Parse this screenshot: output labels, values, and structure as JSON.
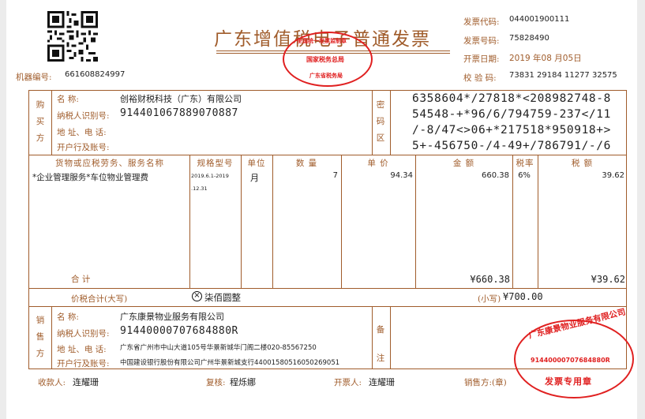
{
  "header": {
    "title": "广东增值税电子普通发票",
    "machine_no_label": "机器编号:",
    "machine_no": "661608824997",
    "invoice_code_label": "发票代码:",
    "invoice_code": "044001900111",
    "invoice_no_label": "发票号码:",
    "invoice_no": "75828490",
    "issue_date_label": "开票日期:",
    "issue_date": "2019 年08 月05日",
    "check_code_label": "校 验 码:",
    "check_code": "73831 29184 11277 32575"
  },
  "tax_stamp": {
    "line1": "全国统一发票监制章",
    "line2": "国家税务总局",
    "line3": "广东省税务局"
  },
  "buyer": {
    "section_label": "购买方",
    "name_label": "名      称:",
    "name": "创裕财税科技（广东）有限公司",
    "tax_id_label": "纳税人识别号:",
    "tax_id": "914401067889070887",
    "address_label": "地 址、电 话:",
    "address": "",
    "bank_label": "开户行及账号:",
    "bank": ""
  },
  "cipher": {
    "section_label": "密码区",
    "lines": [
      "6358604*/27818*<208982748-8",
      "54548-+*96/6/794759-237</11",
      "/-8/47<>06+*217518*950918+>",
      "5+-456750-/4-49+/786791/-/6"
    ]
  },
  "items": {
    "headers": {
      "name": "货物或应税劳务、服务名称",
      "spec": "规格型号",
      "unit": "单位",
      "qty": "数 量",
      "price": "单 价",
      "amount": "金 额",
      "rate": "税率",
      "tax": "税 额"
    },
    "rows": [
      {
        "name": "*企业管理服务*车位物业管理费",
        "spec_line1": "2019.6.1-2019",
        "spec_line2": ".12.31",
        "unit": "月",
        "qty": "7",
        "price": "94.34",
        "amount": "660.38",
        "rate": "6%",
        "tax": "39.62"
      }
    ],
    "total_label": "合      计",
    "total_amount": "¥660.38",
    "total_tax": "¥39.62"
  },
  "grand_total": {
    "label": "价税合计(大写)",
    "cn_words": "柒佰圆整",
    "small_label": "(小写)",
    "small_value": "¥700.00"
  },
  "seller": {
    "section_label": "销售方",
    "name_label": "名      称:",
    "name": "广东康景物业服务有限公司",
    "tax_id_label": "纳税人识别号:",
    "tax_id": "91440000707684880R",
    "address_label": "地 址、电 话:",
    "address": "广东省广州市中山大道105号华景新城华门阁二楼020-85567250",
    "bank_label": "开户行及账号:",
    "bank": "中国建设银行股份有限公司广州华景新城支行44001580516050269051"
  },
  "remarks": {
    "section_label": "备注"
  },
  "seller_stamp": {
    "company": "广东康景物业服务有限公司",
    "tax_id": "91440000707684880R",
    "label": "发票专用章"
  },
  "footer": {
    "payee_label": "收款人:",
    "payee": "连耀珊",
    "reviewer_label": "复核:",
    "reviewer": "程烁娜",
    "drawer_label": "开票人:",
    "drawer": "连耀珊",
    "seller_label": "销售方:(章)"
  },
  "colors": {
    "frame": "#a05c2b",
    "stamp": "#e02020",
    "background": "#ececec"
  }
}
